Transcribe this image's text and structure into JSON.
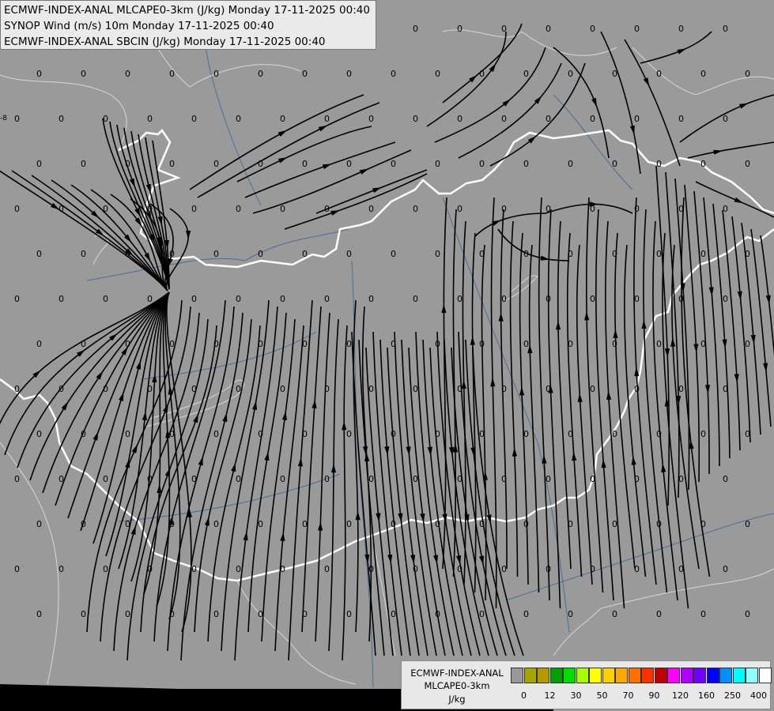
{
  "header": {
    "line1": "ECMWF-INDEX-ANAL MLCAPE0-3km (J/kg) Monday 17-11-2025 00:40",
    "line2": "SYNOP Wind (m/s) 10m Monday 17-11-2025 00:40",
    "line3": "ECMWF-INDEX-ANAL SBCIN (J/kg) Monday 17-11-2025 00:40"
  },
  "legend": {
    "title1": "ECMWF-INDEX-ANAL",
    "title2": "MLCAPE0-3km",
    "unit": "J/kg",
    "colors": [
      "#999999",
      "#a5a500",
      "#b39a00",
      "#00a000",
      "#00e000",
      "#a8ff00",
      "#ffff00",
      "#ffd000",
      "#ffa800",
      "#ff7000",
      "#ff3000",
      "#c00000",
      "#ff00ff",
      "#b000ff",
      "#7000ff",
      "#0000ff",
      "#0090ff",
      "#00ffff",
      "#90ffff",
      "#ffffff"
    ],
    "ticks": [
      {
        "label": "0",
        "index": 1
      },
      {
        "label": "12",
        "index": 3
      },
      {
        "label": "30",
        "index": 5
      },
      {
        "label": "50",
        "index": 7
      },
      {
        "label": "70",
        "index": 9
      },
      {
        "label": "90",
        "index": 11
      },
      {
        "label": "120",
        "index": 13
      },
      {
        "label": "160",
        "index": 15
      },
      {
        "label": "250",
        "index": 17
      },
      {
        "label": "400",
        "index": 19
      }
    ]
  },
  "map": {
    "background": "#9a9a9a",
    "value_label": "0",
    "edge_label": "-8"
  }
}
